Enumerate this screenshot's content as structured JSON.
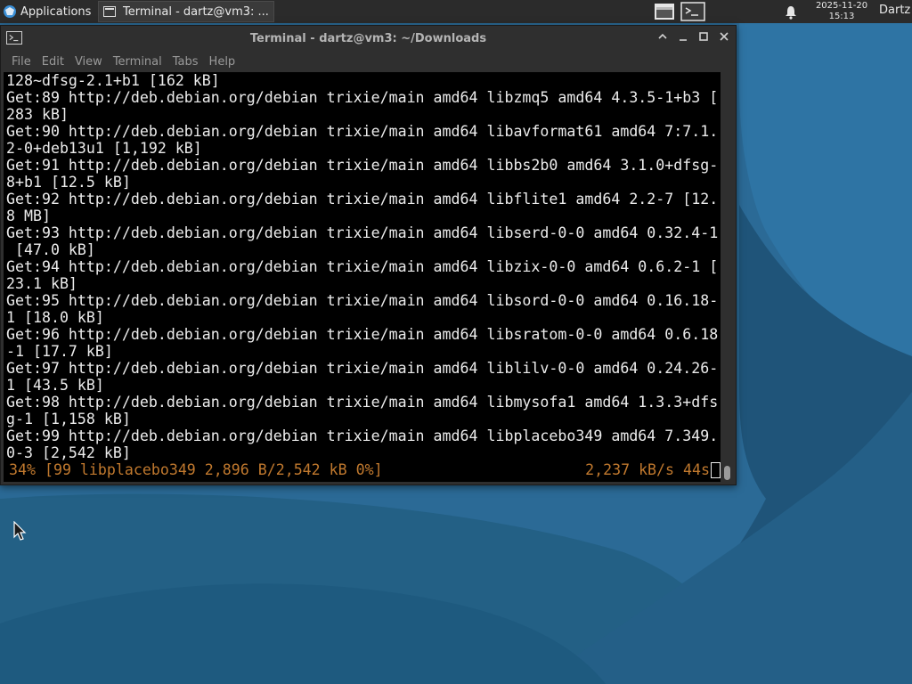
{
  "panel": {
    "apps_label": "Applications",
    "task_label": "Terminal - dartz@vm3: ...",
    "clock_date": "2025-11-20",
    "clock_time": "15:13",
    "user": "Dartz"
  },
  "window": {
    "title": "Terminal - dartz@vm3: ~/Downloads",
    "menu": [
      "File",
      "Edit",
      "View",
      "Terminal",
      "Tabs",
      "Help"
    ]
  },
  "terminal": {
    "lines": [
      "128~dfsg-2.1+b1 [162 kB]",
      "Get:89 http://deb.debian.org/debian trixie/main amd64 libzmq5 amd64 4.3.5-1+b3 [",
      "283 kB]",
      "Get:90 http://deb.debian.org/debian trixie/main amd64 libavformat61 amd64 7:7.1.",
      "2-0+deb13u1 [1,192 kB]",
      "Get:91 http://deb.debian.org/debian trixie/main amd64 libbs2b0 amd64 3.1.0+dfsg-",
      "8+b1 [12.5 kB]",
      "Get:92 http://deb.debian.org/debian trixie/main amd64 libflite1 amd64 2.2-7 [12.",
      "8 MB]",
      "Get:93 http://deb.debian.org/debian trixie/main amd64 libserd-0-0 amd64 0.32.4-1",
      " [47.0 kB]",
      "Get:94 http://deb.debian.org/debian trixie/main amd64 libzix-0-0 amd64 0.6.2-1 [",
      "23.1 kB]",
      "Get:95 http://deb.debian.org/debian trixie/main amd64 libsord-0-0 amd64 0.16.18-",
      "1 [18.0 kB]",
      "Get:96 http://deb.debian.org/debian trixie/main amd64 libsratom-0-0 amd64 0.6.18",
      "-1 [17.7 kB]",
      "Get:97 http://deb.debian.org/debian trixie/main amd64 liblilv-0-0 amd64 0.24.26-",
      "1 [43.5 kB]",
      "Get:98 http://deb.debian.org/debian trixie/main amd64 libmysofa1 amd64 1.3.3+dfs",
      "g-1 [1,158 kB]",
      "Get:99 http://deb.debian.org/debian trixie/main amd64 libplacebo349 amd64 7.349.",
      "0-3 [2,542 kB]"
    ],
    "status_left": "34% [99 libplacebo349 2,896 B/2,542 kB 0%]",
    "status_right": "2,237 kB/s 44s",
    "status_color": "#c1792e"
  },
  "icons": {
    "apps": "xfce-logo-icon",
    "task": "terminal-icon",
    "notification": "bell-icon"
  }
}
